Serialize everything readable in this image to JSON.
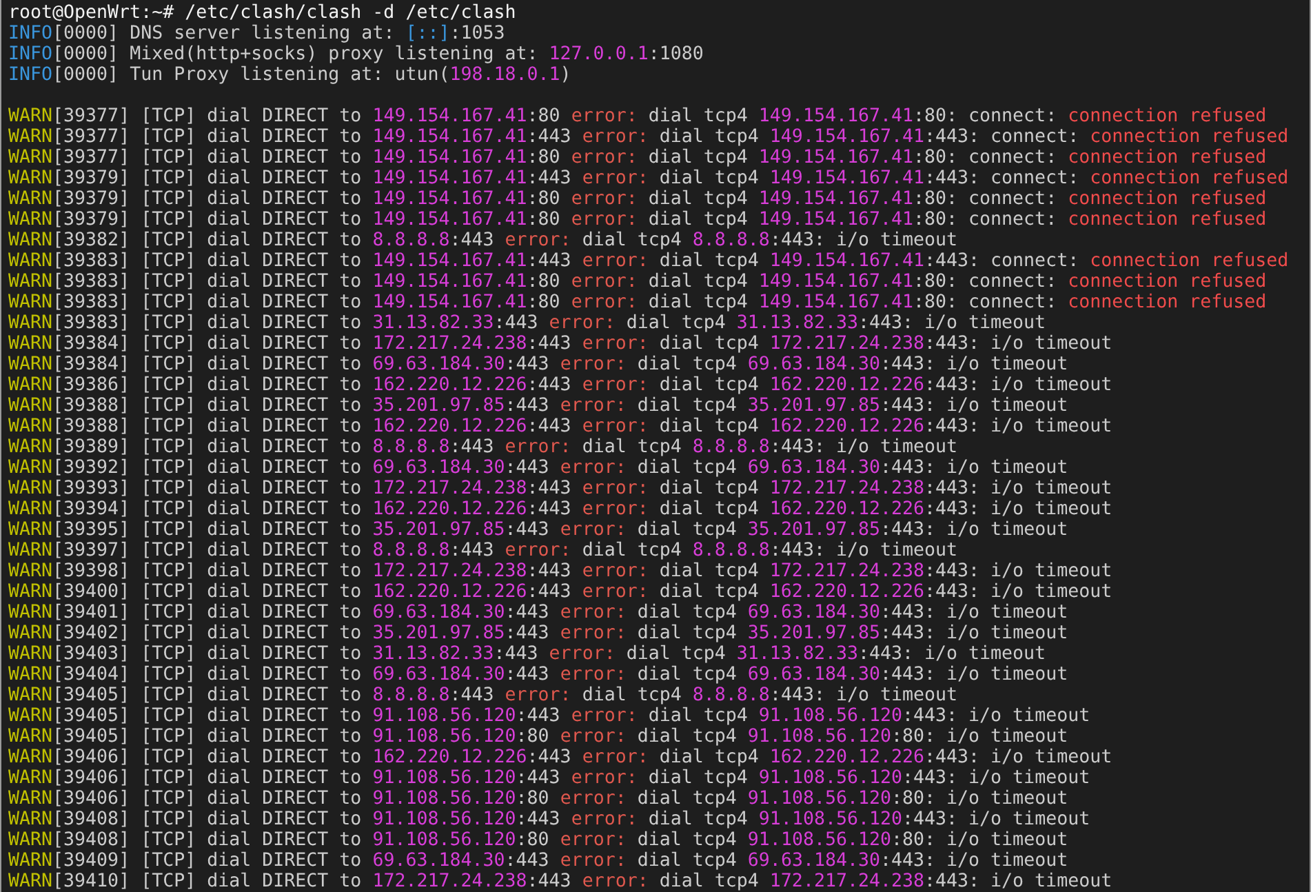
{
  "terminal": {
    "lines": [
      {
        "kind": "command",
        "segments": [
          {
            "kind": "c",
            "t": "root@OpenWrt:~# /etc/clash/clash -d /etc/clash"
          }
        ]
      },
      {
        "kind": "info",
        "segments": [
          {
            "kind": "i",
            "t": "INFO"
          },
          {
            "kind": "p",
            "t": "[0000] DNS server listening at: "
          },
          {
            "kind": "i",
            "t": "[::]"
          },
          {
            "kind": "p",
            "t": ":1053"
          }
        ]
      },
      {
        "kind": "info",
        "segments": [
          {
            "kind": "i",
            "t": "INFO"
          },
          {
            "kind": "p",
            "t": "[0000] Mixed(http+socks) proxy listening at: "
          },
          {
            "kind": "ip",
            "t": "127.0.0.1"
          },
          {
            "kind": "p",
            "t": ":1080"
          }
        ]
      },
      {
        "kind": "info",
        "segments": [
          {
            "kind": "i",
            "t": "INFO"
          },
          {
            "kind": "p",
            "t": "[0000] Tun Proxy listening at: utun("
          },
          {
            "kind": "ip",
            "t": "198.18.0.1"
          },
          {
            "kind": "p",
            "t": ")"
          }
        ]
      },
      {
        "kind": "blank"
      },
      {
        "kind": "warn",
        "segments": [
          {
            "kind": "w",
            "t": "WARN"
          },
          {
            "kind": "p",
            "t": "[39377] [TCP] dial DIRECT to "
          },
          {
            "kind": "ip",
            "t": "149.154.167.41"
          },
          {
            "kind": "p",
            "t": ":80 "
          },
          {
            "kind": "e",
            "t": "error:"
          },
          {
            "kind": "p",
            "t": " dial tcp4 "
          },
          {
            "kind": "ip",
            "t": "149.154.167.41"
          },
          {
            "kind": "p",
            "t": ":80: connect: "
          },
          {
            "kind": "r",
            "t": "connection refused"
          }
        ]
      },
      {
        "kind": "warn",
        "segments": [
          {
            "kind": "w",
            "t": "WARN"
          },
          {
            "kind": "p",
            "t": "[39377] [TCP] dial DIRECT to "
          },
          {
            "kind": "ip",
            "t": "149.154.167.41"
          },
          {
            "kind": "p",
            "t": ":443 "
          },
          {
            "kind": "e",
            "t": "error:"
          },
          {
            "kind": "p",
            "t": " dial tcp4 "
          },
          {
            "kind": "ip",
            "t": "149.154.167.41"
          },
          {
            "kind": "p",
            "t": ":443: connect: "
          },
          {
            "kind": "r",
            "t": "connection refused"
          }
        ]
      },
      {
        "kind": "warn",
        "segments": [
          {
            "kind": "w",
            "t": "WARN"
          },
          {
            "kind": "p",
            "t": "[39377] [TCP] dial DIRECT to "
          },
          {
            "kind": "ip",
            "t": "149.154.167.41"
          },
          {
            "kind": "p",
            "t": ":80 "
          },
          {
            "kind": "e",
            "t": "error:"
          },
          {
            "kind": "p",
            "t": " dial tcp4 "
          },
          {
            "kind": "ip",
            "t": "149.154.167.41"
          },
          {
            "kind": "p",
            "t": ":80: connect: "
          },
          {
            "kind": "r",
            "t": "connection refused"
          }
        ]
      },
      {
        "kind": "warn",
        "segments": [
          {
            "kind": "w",
            "t": "WARN"
          },
          {
            "kind": "p",
            "t": "[39379] [TCP] dial DIRECT to "
          },
          {
            "kind": "ip",
            "t": "149.154.167.41"
          },
          {
            "kind": "p",
            "t": ":443 "
          },
          {
            "kind": "e",
            "t": "error:"
          },
          {
            "kind": "p",
            "t": " dial tcp4 "
          },
          {
            "kind": "ip",
            "t": "149.154.167.41"
          },
          {
            "kind": "p",
            "t": ":443: connect: "
          },
          {
            "kind": "r",
            "t": "connection refused"
          }
        ]
      },
      {
        "kind": "warn",
        "segments": [
          {
            "kind": "w",
            "t": "WARN"
          },
          {
            "kind": "p",
            "t": "[39379] [TCP] dial DIRECT to "
          },
          {
            "kind": "ip",
            "t": "149.154.167.41"
          },
          {
            "kind": "p",
            "t": ":80 "
          },
          {
            "kind": "e",
            "t": "error:"
          },
          {
            "kind": "p",
            "t": " dial tcp4 "
          },
          {
            "kind": "ip",
            "t": "149.154.167.41"
          },
          {
            "kind": "p",
            "t": ":80: connect: "
          },
          {
            "kind": "r",
            "t": "connection refused"
          }
        ]
      },
      {
        "kind": "warn",
        "segments": [
          {
            "kind": "w",
            "t": "WARN"
          },
          {
            "kind": "p",
            "t": "[39379] [TCP] dial DIRECT to "
          },
          {
            "kind": "ip",
            "t": "149.154.167.41"
          },
          {
            "kind": "p",
            "t": ":80 "
          },
          {
            "kind": "e",
            "t": "error:"
          },
          {
            "kind": "p",
            "t": " dial tcp4 "
          },
          {
            "kind": "ip",
            "t": "149.154.167.41"
          },
          {
            "kind": "p",
            "t": ":80: connect: "
          },
          {
            "kind": "r",
            "t": "connection refused"
          }
        ]
      },
      {
        "kind": "warn",
        "segments": [
          {
            "kind": "w",
            "t": "WARN"
          },
          {
            "kind": "p",
            "t": "[39382] [TCP] dial DIRECT to "
          },
          {
            "kind": "ip",
            "t": "8.8.8.8"
          },
          {
            "kind": "p",
            "t": ":443 "
          },
          {
            "kind": "e",
            "t": "error:"
          },
          {
            "kind": "p",
            "t": " dial tcp4 "
          },
          {
            "kind": "ip",
            "t": "8.8.8.8"
          },
          {
            "kind": "p",
            "t": ":443: i/o timeout"
          }
        ]
      },
      {
        "kind": "warn",
        "segments": [
          {
            "kind": "w",
            "t": "WARN"
          },
          {
            "kind": "p",
            "t": "[39383] [TCP] dial DIRECT to "
          },
          {
            "kind": "ip",
            "t": "149.154.167.41"
          },
          {
            "kind": "p",
            "t": ":443 "
          },
          {
            "kind": "e",
            "t": "error:"
          },
          {
            "kind": "p",
            "t": " dial tcp4 "
          },
          {
            "kind": "ip",
            "t": "149.154.167.41"
          },
          {
            "kind": "p",
            "t": ":443: connect: "
          },
          {
            "kind": "r",
            "t": "connection refused"
          }
        ]
      },
      {
        "kind": "warn",
        "segments": [
          {
            "kind": "w",
            "t": "WARN"
          },
          {
            "kind": "p",
            "t": "[39383] [TCP] dial DIRECT to "
          },
          {
            "kind": "ip",
            "t": "149.154.167.41"
          },
          {
            "kind": "p",
            "t": ":80 "
          },
          {
            "kind": "e",
            "t": "error:"
          },
          {
            "kind": "p",
            "t": " dial tcp4 "
          },
          {
            "kind": "ip",
            "t": "149.154.167.41"
          },
          {
            "kind": "p",
            "t": ":80: connect: "
          },
          {
            "kind": "r",
            "t": "connection refused"
          }
        ]
      },
      {
        "kind": "warn",
        "segments": [
          {
            "kind": "w",
            "t": "WARN"
          },
          {
            "kind": "p",
            "t": "[39383] [TCP] dial DIRECT to "
          },
          {
            "kind": "ip",
            "t": "149.154.167.41"
          },
          {
            "kind": "p",
            "t": ":80 "
          },
          {
            "kind": "e",
            "t": "error:"
          },
          {
            "kind": "p",
            "t": " dial tcp4 "
          },
          {
            "kind": "ip",
            "t": "149.154.167.41"
          },
          {
            "kind": "p",
            "t": ":80: connect: "
          },
          {
            "kind": "r",
            "t": "connection refused"
          }
        ]
      },
      {
        "kind": "warn",
        "segments": [
          {
            "kind": "w",
            "t": "WARN"
          },
          {
            "kind": "p",
            "t": "[39383] [TCP] dial DIRECT to "
          },
          {
            "kind": "ip",
            "t": "31.13.82.33"
          },
          {
            "kind": "p",
            "t": ":443 "
          },
          {
            "kind": "e",
            "t": "error:"
          },
          {
            "kind": "p",
            "t": " dial tcp4 "
          },
          {
            "kind": "ip",
            "t": "31.13.82.33"
          },
          {
            "kind": "p",
            "t": ":443: i/o timeout"
          }
        ]
      },
      {
        "kind": "warn",
        "segments": [
          {
            "kind": "w",
            "t": "WARN"
          },
          {
            "kind": "p",
            "t": "[39384] [TCP] dial DIRECT to "
          },
          {
            "kind": "ip",
            "t": "172.217.24.238"
          },
          {
            "kind": "p",
            "t": ":443 "
          },
          {
            "kind": "e",
            "t": "error:"
          },
          {
            "kind": "p",
            "t": " dial tcp4 "
          },
          {
            "kind": "ip",
            "t": "172.217.24.238"
          },
          {
            "kind": "p",
            "t": ":443: i/o timeout"
          }
        ]
      },
      {
        "kind": "warn",
        "segments": [
          {
            "kind": "w",
            "t": "WARN"
          },
          {
            "kind": "p",
            "t": "[39384] [TCP] dial DIRECT to "
          },
          {
            "kind": "ip",
            "t": "69.63.184.30"
          },
          {
            "kind": "p",
            "t": ":443 "
          },
          {
            "kind": "e",
            "t": "error:"
          },
          {
            "kind": "p",
            "t": " dial tcp4 "
          },
          {
            "kind": "ip",
            "t": "69.63.184.30"
          },
          {
            "kind": "p",
            "t": ":443: i/o timeout"
          }
        ]
      },
      {
        "kind": "warn",
        "segments": [
          {
            "kind": "w",
            "t": "WARN"
          },
          {
            "kind": "p",
            "t": "[39386] [TCP] dial DIRECT to "
          },
          {
            "kind": "ip",
            "t": "162.220.12.226"
          },
          {
            "kind": "p",
            "t": ":443 "
          },
          {
            "kind": "e",
            "t": "error:"
          },
          {
            "kind": "p",
            "t": " dial tcp4 "
          },
          {
            "kind": "ip",
            "t": "162.220.12.226"
          },
          {
            "kind": "p",
            "t": ":443: i/o timeout"
          }
        ]
      },
      {
        "kind": "warn",
        "segments": [
          {
            "kind": "w",
            "t": "WARN"
          },
          {
            "kind": "p",
            "t": "[39388] [TCP] dial DIRECT to "
          },
          {
            "kind": "ip",
            "t": "35.201.97.85"
          },
          {
            "kind": "p",
            "t": ":443 "
          },
          {
            "kind": "e",
            "t": "error:"
          },
          {
            "kind": "p",
            "t": " dial tcp4 "
          },
          {
            "kind": "ip",
            "t": "35.201.97.85"
          },
          {
            "kind": "p",
            "t": ":443: i/o timeout"
          }
        ]
      },
      {
        "kind": "warn",
        "segments": [
          {
            "kind": "w",
            "t": "WARN"
          },
          {
            "kind": "p",
            "t": "[39388] [TCP] dial DIRECT to "
          },
          {
            "kind": "ip",
            "t": "162.220.12.226"
          },
          {
            "kind": "p",
            "t": ":443 "
          },
          {
            "kind": "e",
            "t": "error:"
          },
          {
            "kind": "p",
            "t": " dial tcp4 "
          },
          {
            "kind": "ip",
            "t": "162.220.12.226"
          },
          {
            "kind": "p",
            "t": ":443: i/o timeout"
          }
        ]
      },
      {
        "kind": "warn",
        "segments": [
          {
            "kind": "w",
            "t": "WARN"
          },
          {
            "kind": "p",
            "t": "[39389] [TCP] dial DIRECT to "
          },
          {
            "kind": "ip",
            "t": "8.8.8.8"
          },
          {
            "kind": "p",
            "t": ":443 "
          },
          {
            "kind": "e",
            "t": "error:"
          },
          {
            "kind": "p",
            "t": " dial tcp4 "
          },
          {
            "kind": "ip",
            "t": "8.8.8.8"
          },
          {
            "kind": "p",
            "t": ":443: i/o timeout"
          }
        ]
      },
      {
        "kind": "warn",
        "segments": [
          {
            "kind": "w",
            "t": "WARN"
          },
          {
            "kind": "p",
            "t": "[39392] [TCP] dial DIRECT to "
          },
          {
            "kind": "ip",
            "t": "69.63.184.30"
          },
          {
            "kind": "p",
            "t": ":443 "
          },
          {
            "kind": "e",
            "t": "error:"
          },
          {
            "kind": "p",
            "t": " dial tcp4 "
          },
          {
            "kind": "ip",
            "t": "69.63.184.30"
          },
          {
            "kind": "p",
            "t": ":443: i/o timeout"
          }
        ]
      },
      {
        "kind": "warn",
        "segments": [
          {
            "kind": "w",
            "t": "WARN"
          },
          {
            "kind": "p",
            "t": "[39393] [TCP] dial DIRECT to "
          },
          {
            "kind": "ip",
            "t": "172.217.24.238"
          },
          {
            "kind": "p",
            "t": ":443 "
          },
          {
            "kind": "e",
            "t": "error:"
          },
          {
            "kind": "p",
            "t": " dial tcp4 "
          },
          {
            "kind": "ip",
            "t": "172.217.24.238"
          },
          {
            "kind": "p",
            "t": ":443: i/o timeout"
          }
        ]
      },
      {
        "kind": "warn",
        "segments": [
          {
            "kind": "w",
            "t": "WARN"
          },
          {
            "kind": "p",
            "t": "[39394] [TCP] dial DIRECT to "
          },
          {
            "kind": "ip",
            "t": "162.220.12.226"
          },
          {
            "kind": "p",
            "t": ":443 "
          },
          {
            "kind": "e",
            "t": "error:"
          },
          {
            "kind": "p",
            "t": " dial tcp4 "
          },
          {
            "kind": "ip",
            "t": "162.220.12.226"
          },
          {
            "kind": "p",
            "t": ":443: i/o timeout"
          }
        ]
      },
      {
        "kind": "warn",
        "segments": [
          {
            "kind": "w",
            "t": "WARN"
          },
          {
            "kind": "p",
            "t": "[39395] [TCP] dial DIRECT to "
          },
          {
            "kind": "ip",
            "t": "35.201.97.85"
          },
          {
            "kind": "p",
            "t": ":443 "
          },
          {
            "kind": "e",
            "t": "error:"
          },
          {
            "kind": "p",
            "t": " dial tcp4 "
          },
          {
            "kind": "ip",
            "t": "35.201.97.85"
          },
          {
            "kind": "p",
            "t": ":443: i/o timeout"
          }
        ]
      },
      {
        "kind": "warn",
        "segments": [
          {
            "kind": "w",
            "t": "WARN"
          },
          {
            "kind": "p",
            "t": "[39397] [TCP] dial DIRECT to "
          },
          {
            "kind": "ip",
            "t": "8.8.8.8"
          },
          {
            "kind": "p",
            "t": ":443 "
          },
          {
            "kind": "e",
            "t": "error:"
          },
          {
            "kind": "p",
            "t": " dial tcp4 "
          },
          {
            "kind": "ip",
            "t": "8.8.8.8"
          },
          {
            "kind": "p",
            "t": ":443: i/o timeout"
          }
        ]
      },
      {
        "kind": "warn",
        "segments": [
          {
            "kind": "w",
            "t": "WARN"
          },
          {
            "kind": "p",
            "t": "[39398] [TCP] dial DIRECT to "
          },
          {
            "kind": "ip",
            "t": "172.217.24.238"
          },
          {
            "kind": "p",
            "t": ":443 "
          },
          {
            "kind": "e",
            "t": "error:"
          },
          {
            "kind": "p",
            "t": " dial tcp4 "
          },
          {
            "kind": "ip",
            "t": "172.217.24.238"
          },
          {
            "kind": "p",
            "t": ":443: i/o timeout"
          }
        ]
      },
      {
        "kind": "warn",
        "segments": [
          {
            "kind": "w",
            "t": "WARN"
          },
          {
            "kind": "p",
            "t": "[39400] [TCP] dial DIRECT to "
          },
          {
            "kind": "ip",
            "t": "162.220.12.226"
          },
          {
            "kind": "p",
            "t": ":443 "
          },
          {
            "kind": "e",
            "t": "error:"
          },
          {
            "kind": "p",
            "t": " dial tcp4 "
          },
          {
            "kind": "ip",
            "t": "162.220.12.226"
          },
          {
            "kind": "p",
            "t": ":443: i/o timeout"
          }
        ]
      },
      {
        "kind": "warn",
        "segments": [
          {
            "kind": "w",
            "t": "WARN"
          },
          {
            "kind": "p",
            "t": "[39401] [TCP] dial DIRECT to "
          },
          {
            "kind": "ip",
            "t": "69.63.184.30"
          },
          {
            "kind": "p",
            "t": ":443 "
          },
          {
            "kind": "e",
            "t": "error:"
          },
          {
            "kind": "p",
            "t": " dial tcp4 "
          },
          {
            "kind": "ip",
            "t": "69.63.184.30"
          },
          {
            "kind": "p",
            "t": ":443: i/o timeout"
          }
        ]
      },
      {
        "kind": "warn",
        "segments": [
          {
            "kind": "w",
            "t": "WARN"
          },
          {
            "kind": "p",
            "t": "[39402] [TCP] dial DIRECT to "
          },
          {
            "kind": "ip",
            "t": "35.201.97.85"
          },
          {
            "kind": "p",
            "t": ":443 "
          },
          {
            "kind": "e",
            "t": "error:"
          },
          {
            "kind": "p",
            "t": " dial tcp4 "
          },
          {
            "kind": "ip",
            "t": "35.201.97.85"
          },
          {
            "kind": "p",
            "t": ":443: i/o timeout"
          }
        ]
      },
      {
        "kind": "warn",
        "segments": [
          {
            "kind": "w",
            "t": "WARN"
          },
          {
            "kind": "p",
            "t": "[39403] [TCP] dial DIRECT to "
          },
          {
            "kind": "ip",
            "t": "31.13.82.33"
          },
          {
            "kind": "p",
            "t": ":443 "
          },
          {
            "kind": "e",
            "t": "error:"
          },
          {
            "kind": "p",
            "t": " dial tcp4 "
          },
          {
            "kind": "ip",
            "t": "31.13.82.33"
          },
          {
            "kind": "p",
            "t": ":443: i/o timeout"
          }
        ]
      },
      {
        "kind": "warn",
        "segments": [
          {
            "kind": "w",
            "t": "WARN"
          },
          {
            "kind": "p",
            "t": "[39404] [TCP] dial DIRECT to "
          },
          {
            "kind": "ip",
            "t": "69.63.184.30"
          },
          {
            "kind": "p",
            "t": ":443 "
          },
          {
            "kind": "e",
            "t": "error:"
          },
          {
            "kind": "p",
            "t": " dial tcp4 "
          },
          {
            "kind": "ip",
            "t": "69.63.184.30"
          },
          {
            "kind": "p",
            "t": ":443: i/o timeout"
          }
        ]
      },
      {
        "kind": "warn",
        "segments": [
          {
            "kind": "w",
            "t": "WARN"
          },
          {
            "kind": "p",
            "t": "[39405] [TCP] dial DIRECT to "
          },
          {
            "kind": "ip",
            "t": "8.8.8.8"
          },
          {
            "kind": "p",
            "t": ":443 "
          },
          {
            "kind": "e",
            "t": "error:"
          },
          {
            "kind": "p",
            "t": " dial tcp4 "
          },
          {
            "kind": "ip",
            "t": "8.8.8.8"
          },
          {
            "kind": "p",
            "t": ":443: i/o timeout"
          }
        ]
      },
      {
        "kind": "warn",
        "segments": [
          {
            "kind": "w",
            "t": "WARN"
          },
          {
            "kind": "p",
            "t": "[39405] [TCP] dial DIRECT to "
          },
          {
            "kind": "ip",
            "t": "91.108.56.120"
          },
          {
            "kind": "p",
            "t": ":443 "
          },
          {
            "kind": "e",
            "t": "error:"
          },
          {
            "kind": "p",
            "t": " dial tcp4 "
          },
          {
            "kind": "ip",
            "t": "91.108.56.120"
          },
          {
            "kind": "p",
            "t": ":443: i/o timeout"
          }
        ]
      },
      {
        "kind": "warn",
        "segments": [
          {
            "kind": "w",
            "t": "WARN"
          },
          {
            "kind": "p",
            "t": "[39405] [TCP] dial DIRECT to "
          },
          {
            "kind": "ip",
            "t": "91.108.56.120"
          },
          {
            "kind": "p",
            "t": ":80 "
          },
          {
            "kind": "e",
            "t": "error:"
          },
          {
            "kind": "p",
            "t": " dial tcp4 "
          },
          {
            "kind": "ip",
            "t": "91.108.56.120"
          },
          {
            "kind": "p",
            "t": ":80: i/o timeout"
          }
        ]
      },
      {
        "kind": "warn",
        "segments": [
          {
            "kind": "w",
            "t": "WARN"
          },
          {
            "kind": "p",
            "t": "[39406] [TCP] dial DIRECT to "
          },
          {
            "kind": "ip",
            "t": "162.220.12.226"
          },
          {
            "kind": "p",
            "t": ":443 "
          },
          {
            "kind": "e",
            "t": "error:"
          },
          {
            "kind": "p",
            "t": " dial tcp4 "
          },
          {
            "kind": "ip",
            "t": "162.220.12.226"
          },
          {
            "kind": "p",
            "t": ":443: i/o timeout"
          }
        ]
      },
      {
        "kind": "warn",
        "segments": [
          {
            "kind": "w",
            "t": "WARN"
          },
          {
            "kind": "p",
            "t": "[39406] [TCP] dial DIRECT to "
          },
          {
            "kind": "ip",
            "t": "91.108.56.120"
          },
          {
            "kind": "p",
            "t": ":443 "
          },
          {
            "kind": "e",
            "t": "error:"
          },
          {
            "kind": "p",
            "t": " dial tcp4 "
          },
          {
            "kind": "ip",
            "t": "91.108.56.120"
          },
          {
            "kind": "p",
            "t": ":443: i/o timeout"
          }
        ]
      },
      {
        "kind": "warn",
        "segments": [
          {
            "kind": "w",
            "t": "WARN"
          },
          {
            "kind": "p",
            "t": "[39406] [TCP] dial DIRECT to "
          },
          {
            "kind": "ip",
            "t": "91.108.56.120"
          },
          {
            "kind": "p",
            "t": ":80 "
          },
          {
            "kind": "e",
            "t": "error:"
          },
          {
            "kind": "p",
            "t": " dial tcp4 "
          },
          {
            "kind": "ip",
            "t": "91.108.56.120"
          },
          {
            "kind": "p",
            "t": ":80: i/o timeout"
          }
        ]
      },
      {
        "kind": "warn",
        "segments": [
          {
            "kind": "w",
            "t": "WARN"
          },
          {
            "kind": "p",
            "t": "[39408] [TCP] dial DIRECT to "
          },
          {
            "kind": "ip",
            "t": "91.108.56.120"
          },
          {
            "kind": "p",
            "t": ":443 "
          },
          {
            "kind": "e",
            "t": "error:"
          },
          {
            "kind": "p",
            "t": " dial tcp4 "
          },
          {
            "kind": "ip",
            "t": "91.108.56.120"
          },
          {
            "kind": "p",
            "t": ":443: i/o timeout"
          }
        ]
      },
      {
        "kind": "warn",
        "segments": [
          {
            "kind": "w",
            "t": "WARN"
          },
          {
            "kind": "p",
            "t": "[39408] [TCP] dial DIRECT to "
          },
          {
            "kind": "ip",
            "t": "91.108.56.120"
          },
          {
            "kind": "p",
            "t": ":80 "
          },
          {
            "kind": "e",
            "t": "error:"
          },
          {
            "kind": "p",
            "t": " dial tcp4 "
          },
          {
            "kind": "ip",
            "t": "91.108.56.120"
          },
          {
            "kind": "p",
            "t": ":80: i/o timeout"
          }
        ]
      },
      {
        "kind": "warn",
        "segments": [
          {
            "kind": "w",
            "t": "WARN"
          },
          {
            "kind": "p",
            "t": "[39409] [TCP] dial DIRECT to "
          },
          {
            "kind": "ip",
            "t": "69.63.184.30"
          },
          {
            "kind": "p",
            "t": ":443 "
          },
          {
            "kind": "e",
            "t": "error:"
          },
          {
            "kind": "p",
            "t": " dial tcp4 "
          },
          {
            "kind": "ip",
            "t": "69.63.184.30"
          },
          {
            "kind": "p",
            "t": ":443: i/o timeout"
          }
        ]
      },
      {
        "kind": "warn",
        "segments": [
          {
            "kind": "w",
            "t": "WARN"
          },
          {
            "kind": "p",
            "t": "[39410] [TCP] dial DIRECT to "
          },
          {
            "kind": "ip",
            "t": "172.217.24.238"
          },
          {
            "kind": "p",
            "t": ":443 "
          },
          {
            "kind": "e",
            "t": "error:"
          },
          {
            "kind": "p",
            "t": " dial tcp4 "
          },
          {
            "kind": "ip",
            "t": "172.217.24.238"
          },
          {
            "kind": "p",
            "t": ":443: i/o timeout"
          }
        ]
      }
    ]
  }
}
